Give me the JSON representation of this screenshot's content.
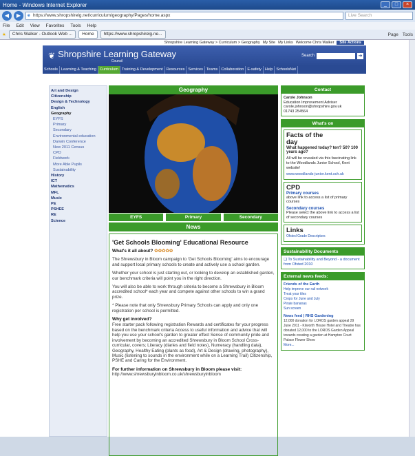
{
  "browser": {
    "title": "Home - Windows Internet Explorer",
    "url": "https://www.shropshirelg.net/curriculum/geography/Pages/home.aspx",
    "search_placeholder": "Live Search",
    "menu": [
      "File",
      "Edit",
      "View",
      "Favorites",
      "Tools",
      "Help"
    ],
    "tabs": [
      "Chris Walker - Outlook Web ...",
      "Home",
      "https://www.shropshirelg.ne..."
    ],
    "tools": [
      "Page",
      "Tools"
    ]
  },
  "site": {
    "breadcrumb": "Shropshire Learning Gateway > Curriculum > Geography",
    "links": [
      "My Site",
      "My Links",
      "Welcome Chris Walker"
    ],
    "site_actions": "Site Actions",
    "logo": "Shropshire Learning Gateway",
    "logo_sub": "Council",
    "search_label": "Search",
    "nav": [
      "Schools",
      "Learning & Teaching",
      "Curriculum",
      "Training & Development",
      "Resources",
      "Services",
      "Teams",
      "Collaboration",
      "E-safety",
      "Help",
      "SchoolsNet"
    ]
  },
  "left": [
    {
      "t": "Art and Design",
      "k": "b"
    },
    {
      "t": "Citizenship",
      "k": "b"
    },
    {
      "t": "Design & Technology",
      "k": "b"
    },
    {
      "t": "English",
      "k": "b"
    },
    {
      "t": "Geography",
      "k": "cur"
    },
    {
      "t": "EYFS",
      "k": "s"
    },
    {
      "t": "Primary",
      "k": "s"
    },
    {
      "t": "Secondary",
      "k": "s"
    },
    {
      "t": "Environmental education",
      "k": "s"
    },
    {
      "t": "Darwin Conference",
      "k": "s"
    },
    {
      "t": "New 2011 Census",
      "k": "s"
    },
    {
      "t": "CPD",
      "k": "s"
    },
    {
      "t": "Fieldwork",
      "k": "s"
    },
    {
      "t": "More Able Pupils",
      "k": "s"
    },
    {
      "t": "Sustainability",
      "k": "s"
    },
    {
      "t": "History",
      "k": "b"
    },
    {
      "t": "ICT",
      "k": "b"
    },
    {
      "t": "Mathematics",
      "k": "b"
    },
    {
      "t": "MFL",
      "k": "b"
    },
    {
      "t": "Music",
      "k": "b"
    },
    {
      "t": "PE",
      "k": "b"
    },
    {
      "t": "PSHEE",
      "k": "b"
    },
    {
      "t": "RE",
      "k": "b"
    },
    {
      "t": "Science",
      "k": "b"
    }
  ],
  "main": {
    "title": "Geography",
    "subtabs": [
      "EYFS",
      "Primary",
      "Secondary"
    ],
    "news_title": "News",
    "article": {
      "headline": "'Get Schools Blooming' Educational Resource",
      "about": "What's it all about?",
      "p1": "The Shrewsbury in Bloom campaign to 'Get Schools Blooming' aims to encourage and support local primary schools to create and actively use a school garden.",
      "p2": "Whether your school is just starting out, or looking to develop an established garden, our benchmark criteria will point you in the right direction.",
      "p3": "You will also be able to work through criteria to become a Shrewsbury in Bloom accredited school* each year and compete against other schools to win a grand prize.",
      "p4": "* Please note that only Shrewsbury Primary Schools can apply and only one registration per school is permitted.",
      "involved": "Why get involved?",
      "p5": "Free starter pack following registration Rewards and certificates for your progress based on the benchmark criteria Access to useful information and advice that will help you use your school's garden to greater effect Sense of community pride and involvement by becoming an accredited Shrewsbury in Bloom School Cross-curricular, covers; Literacy (diaries and field notes), Numeracy (handling data), Geography, Healthy Eating (plants as food), Art & Design (drawing, photography), Music (listening to sounds in the environment while on a Learning Trail) Citizenship, PSHE and Caring for the Environment.",
      "more": "For further information on Shrewsbury in Bloom please visit:",
      "more_url": "http://www.shrewsburyinbloom.co.uk/shrewsburyinbloom"
    }
  },
  "right": {
    "contact_title": "Contact",
    "contact_name": "Carole Johnson",
    "contact_role": "Education Improvement Adviser",
    "contact_email": "carole.johnson@shropshire.gov.uk",
    "contact_phone": "01743 254564",
    "whatson": "What's on",
    "facts_title": "Facts of the day",
    "facts_q": "What happened today? ten? 50? 100 years ago?",
    "facts_body": "All will be revealed via this fascinating link to the Woodlands Junior School, Kent website!",
    "facts_link": "www.woodlands-junior.kent.sch.uk",
    "cpd": "CPD",
    "primary_courses": "Primary courses",
    "primary_desc": "above link to access a list of primary courses",
    "secondary_courses": "Secondary courses",
    "secondary_desc": "Please select the above link to access a list of secondary courses",
    "links": "Links",
    "ofsted": "Ofsted Grade Descriptors",
    "sustain": "Sustainability Documents",
    "sustain_doc": "To Sustainability and Beyond - a document from Ofsted 2010",
    "ext": "External news feeds:",
    "foe": "Friends of the Earth",
    "foe_items": [
      "Help improve our rail network",
      "Treat your tiles",
      "Crops for June and July",
      "Pirate bananas",
      "Sun screen"
    ],
    "rhs": "News feed | RHS Gardening",
    "rhs_text": "12,000 donation for LOROS garden appeal 29 June 2011 - Kilworth House Hotel and Theatre has donated 12,000 to the LOROS Garden Appeal towards creating a garden at Hampton Court Palace Flower Show",
    "rhs_more": "More..."
  }
}
